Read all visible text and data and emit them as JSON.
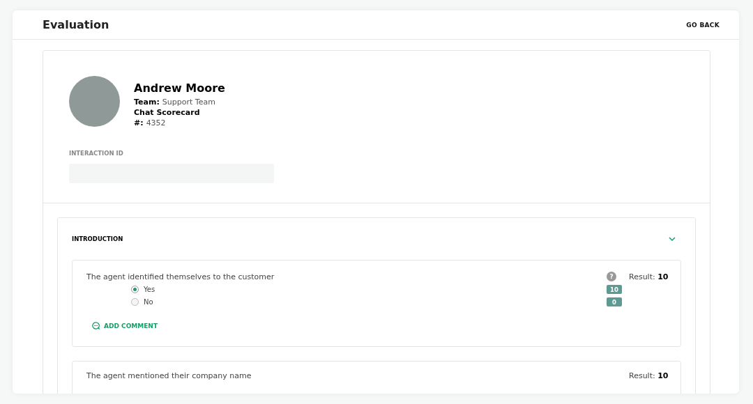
{
  "header": {
    "title": "Evaluation",
    "back_link": "GO BACK"
  },
  "profile": {
    "name": "Andrew Moore",
    "team_label": "Team:",
    "team": "Support Team",
    "scorecard": "Chat Scorecard",
    "number_label": "#:",
    "number": "4352"
  },
  "interaction_id": {
    "label": "INTERACTION ID"
  },
  "section": {
    "title": "INTRODUCTION",
    "expanded": true,
    "questions": [
      {
        "text": "The agent identified themselves to the customer",
        "help": "?",
        "result": "Result: **10**",
        "options": [
          {
            "label": "Yes",
            "score": "10",
            "selected": true
          },
          {
            "label": "No",
            "score": "0",
            "selected": false
          }
        ],
        "comment_link": "ADD COMMENT"
      },
      {
        "text": "The agent mentioned their company name",
        "result": "Result: **10**"
      }
    ]
  }
}
